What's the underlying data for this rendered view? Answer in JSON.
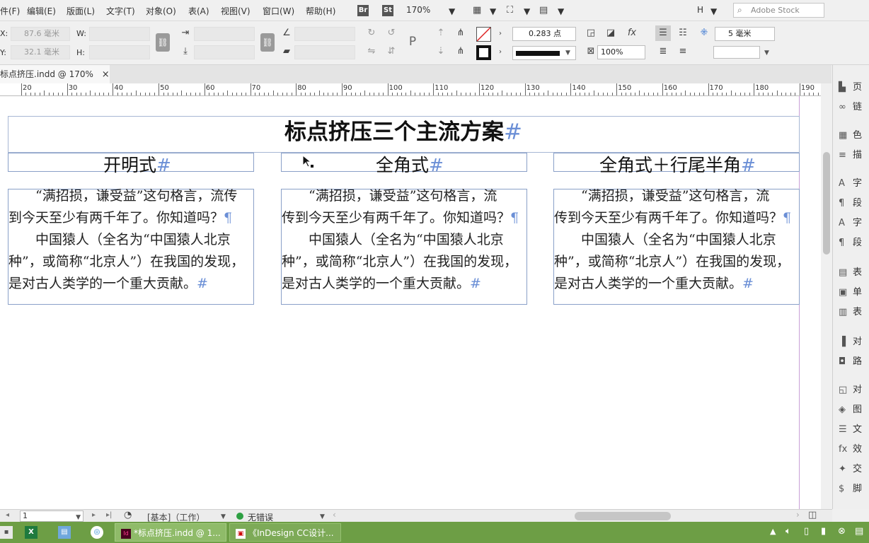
{
  "menu": [
    "件(F)",
    "编辑(E)",
    "版面(L)",
    "文字(T)",
    "对象(O)",
    "表(A)",
    "视图(V)",
    "窗口(W)",
    "帮助(H)"
  ],
  "app_badges": [
    "Br",
    "St"
  ],
  "zoom": "170%",
  "workspace_letter": "H",
  "search_placeholder": "Adobe Stock",
  "control": {
    "x_label": "X:",
    "x_value": "87.6 毫米",
    "y_label": "Y:",
    "y_value": "32.1 毫米",
    "w_label": "W:",
    "h_label": "H:",
    "stroke_weight": "0.283 点",
    "opacity": "100%",
    "spacing_value": "5 毫米"
  },
  "doc_tab": {
    "title": "标点挤压.indd @ 170%",
    "close": "×"
  },
  "ruler_numbers": [
    "20",
    "30",
    "40",
    "50",
    "60",
    "70",
    "80",
    "90",
    "100",
    "110",
    "120",
    "130",
    "140",
    "150",
    "160",
    "170",
    "180",
    "190"
  ],
  "document": {
    "main_title": "标点挤压三个主流方案",
    "hash": "#",
    "pilcrow": "¶",
    "columns": [
      {
        "heading": "开明式",
        "lines": [
          "“满招损，谦受益”这句格言，流传",
          "到今天至少有两千年了。你知道吗？",
          "中国猿人（全名为“中国猿人北京",
          "种”，或简称“北京人”）在我国的发现，",
          "是对古人类学的一个重大贡献。"
        ]
      },
      {
        "heading": "全角式",
        "lines": [
          "“满招损，谦受益”这句格言，流",
          "传到今天至少有两千年了。你知道吗？",
          "中国猿人（全名为“中国猿人北京",
          "种”，或简称“北京人”）在我国的发现，",
          "是对古人类学的一个重大贡献。"
        ]
      },
      {
        "heading": "全角式＋行尾半角",
        "lines": [
          "“满招损，谦受益”这句格言，流",
          "传到今天至少有两千年了。你知道吗？",
          "中国猿人（全名为“中国猿人北京",
          "种”，或简称“北京人”）在我国的发现，",
          "是对古人类学的一个重大贡献。"
        ]
      }
    ]
  },
  "panel_items": [
    {
      "icon": "pages-icon",
      "glyph": "▙",
      "label": "页"
    },
    {
      "icon": "links-icon",
      "glyph": "∞",
      "label": "链"
    },
    {
      "icon": "color-icon",
      "glyph": "▦",
      "label": "色"
    },
    {
      "icon": "stroke-icon",
      "glyph": "≡",
      "label": "描"
    },
    {
      "icon": "character-icon",
      "glyph": "A",
      "label": "字"
    },
    {
      "icon": "paragraph-icon",
      "glyph": "¶",
      "label": "段"
    },
    {
      "icon": "character-styles-icon",
      "glyph": "A",
      "label": "字"
    },
    {
      "icon": "paragraph-styles-icon",
      "glyph": "¶",
      "label": "段"
    },
    {
      "icon": "table-icon",
      "glyph": "▤",
      "label": "表"
    },
    {
      "icon": "cell-styles-icon",
      "glyph": "▣",
      "label": "单"
    },
    {
      "icon": "table-styles-icon",
      "glyph": "▥",
      "label": "表"
    },
    {
      "icon": "align-icon",
      "glyph": "▐",
      "label": "对"
    },
    {
      "icon": "pathfinder-icon",
      "glyph": "◘",
      "label": "路"
    },
    {
      "icon": "object-styles-icon",
      "glyph": "◱",
      "label": "对"
    },
    {
      "icon": "layers-icon",
      "glyph": "◈",
      "label": "图"
    },
    {
      "icon": "text-wrap-icon",
      "glyph": "☰",
      "label": "文"
    },
    {
      "icon": "effects-icon",
      "glyph": "fx",
      "label": "效"
    },
    {
      "icon": "interactive-icon",
      "glyph": "✦",
      "label": "交"
    },
    {
      "icon": "scripts-icon",
      "glyph": "$",
      "label": "脚"
    }
  ],
  "status": {
    "page": "1",
    "style": "[基本]（工作）",
    "preflight": "无错误"
  },
  "taskbar": {
    "apps": [
      "*标点挤压.indd @ 1...",
      "《InDesign CC设计..."
    ]
  },
  "colors": {
    "frame_border": "#8aa0c8",
    "hash_blue": "#6b8fd6",
    "taskbar": "#6d9e45",
    "preflight_ok": "#2ea043"
  }
}
